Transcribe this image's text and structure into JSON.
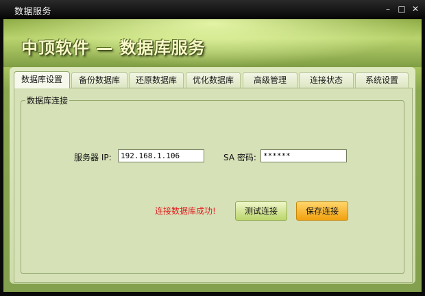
{
  "window": {
    "title": "数据服务",
    "controls": {
      "minimize": "–",
      "maximize": "□",
      "close": "✕"
    }
  },
  "header": {
    "app_title": "中顶软件 — 数据库服务"
  },
  "tabs": [
    {
      "label": "数据库设置",
      "active": true
    },
    {
      "label": "备份数据库",
      "active": false
    },
    {
      "label": "还原数据库",
      "active": false
    },
    {
      "label": "优化数据库",
      "active": false
    },
    {
      "label": "高级管理",
      "active": false
    },
    {
      "label": "连接状态",
      "active": false
    },
    {
      "label": "系统设置",
      "active": false
    }
  ],
  "connection": {
    "group_label": "数据库连接",
    "server_label": "服务器 IP:",
    "server_value": "192.168.1.106",
    "sa_label": "SA 密码:",
    "sa_value": "******",
    "status_text": "连接数据库成功!",
    "test_button": "测试连接",
    "save_button": "保存连接"
  },
  "colors": {
    "status": "#e02020",
    "save_button": "#f1a10f",
    "test_button": "#bcd66c",
    "header": "#a7c460"
  }
}
